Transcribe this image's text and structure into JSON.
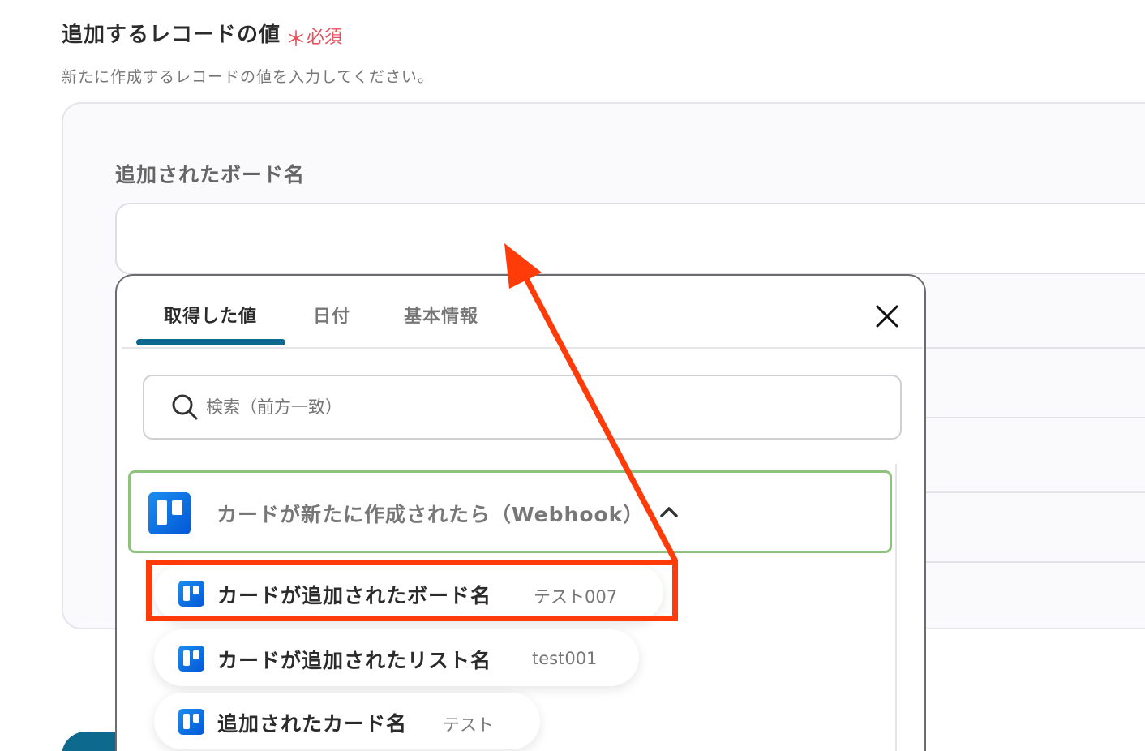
{
  "section": {
    "title": "追加するレコードの値",
    "required_mark": "＊",
    "required_label": "必須",
    "description": "新たに作成するレコードの値を入力してください。"
  },
  "field": {
    "label": "追加されたボード名",
    "value": ""
  },
  "picker": {
    "tabs": [
      {
        "label": "取得した値",
        "active": true
      },
      {
        "label": "日付",
        "active": false
      },
      {
        "label": "基本情報",
        "active": false
      }
    ],
    "search_placeholder": "検索（前方一致）",
    "group": {
      "icon": "trello-icon",
      "title": "カードが新たに作成されたら（Webhook）",
      "expanded": true
    },
    "items": [
      {
        "icon": "trello-icon",
        "label": "カードが追加されたボード名",
        "value": "テスト007",
        "highlighted": true
      },
      {
        "icon": "trello-icon",
        "label": "カードが追加されたリスト名",
        "value": "test001",
        "highlighted": false
      },
      {
        "icon": "trello-icon",
        "label": "追加されたカード名",
        "value": "テスト",
        "highlighted": false
      }
    ]
  },
  "colors": {
    "required": "#e8505b",
    "accent": "#0d6a8e",
    "group_border": "#8fc27f",
    "annotation": "#ff3b0a"
  }
}
